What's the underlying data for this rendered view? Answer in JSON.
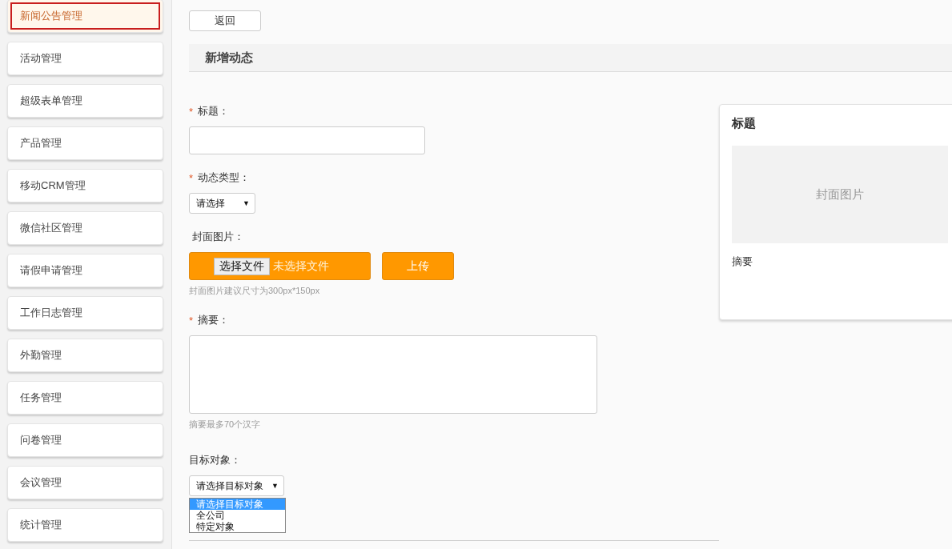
{
  "sidebar": {
    "items": [
      {
        "label": "新闻公告管理",
        "selected": true
      },
      {
        "label": "活动管理",
        "selected": false
      },
      {
        "label": "超级表单管理",
        "selected": false
      },
      {
        "label": "产品管理",
        "selected": false
      },
      {
        "label": "移动CRM管理",
        "selected": false
      },
      {
        "label": "微信社区管理",
        "selected": false
      },
      {
        "label": "请假申请管理",
        "selected": false
      },
      {
        "label": "工作日志管理",
        "selected": false
      },
      {
        "label": "外勤管理",
        "selected": false
      },
      {
        "label": "任务管理",
        "selected": false
      },
      {
        "label": "问卷管理",
        "selected": false
      },
      {
        "label": "会议管理",
        "selected": false
      },
      {
        "label": "统计管理",
        "selected": false
      }
    ]
  },
  "back_button": "返回",
  "section_title": "新增动态",
  "form": {
    "required_mark": "*",
    "fields": [
      {
        "kind": "text",
        "label": "标题：",
        "required": true
      },
      {
        "kind": "select",
        "label": "动态类型：",
        "required": true,
        "value": "请选择",
        "arrow": "▼"
      },
      {
        "kind": "file",
        "label": "封面图片：",
        "required": false,
        "file_button": "选择文件",
        "file_status": "未选择文件",
        "upload_button": "上传",
        "hint": "封面图片建议尺寸为300px*150px"
      },
      {
        "kind": "textarea",
        "label": "摘要：",
        "required": true,
        "hint": "摘要最多70个汉字"
      },
      {
        "kind": "dropdown",
        "label": "目标对象：",
        "required": false,
        "value": "请选择目标对象",
        "arrow": "▼",
        "options": [
          {
            "label": "请选择目标对象",
            "selected": true
          },
          {
            "label": "全公司",
            "selected": false
          },
          {
            "label": "特定对象",
            "selected": false
          }
        ]
      }
    ]
  },
  "preview": {
    "title": "标题",
    "cover": "封面图片",
    "summary": "摘要"
  }
}
